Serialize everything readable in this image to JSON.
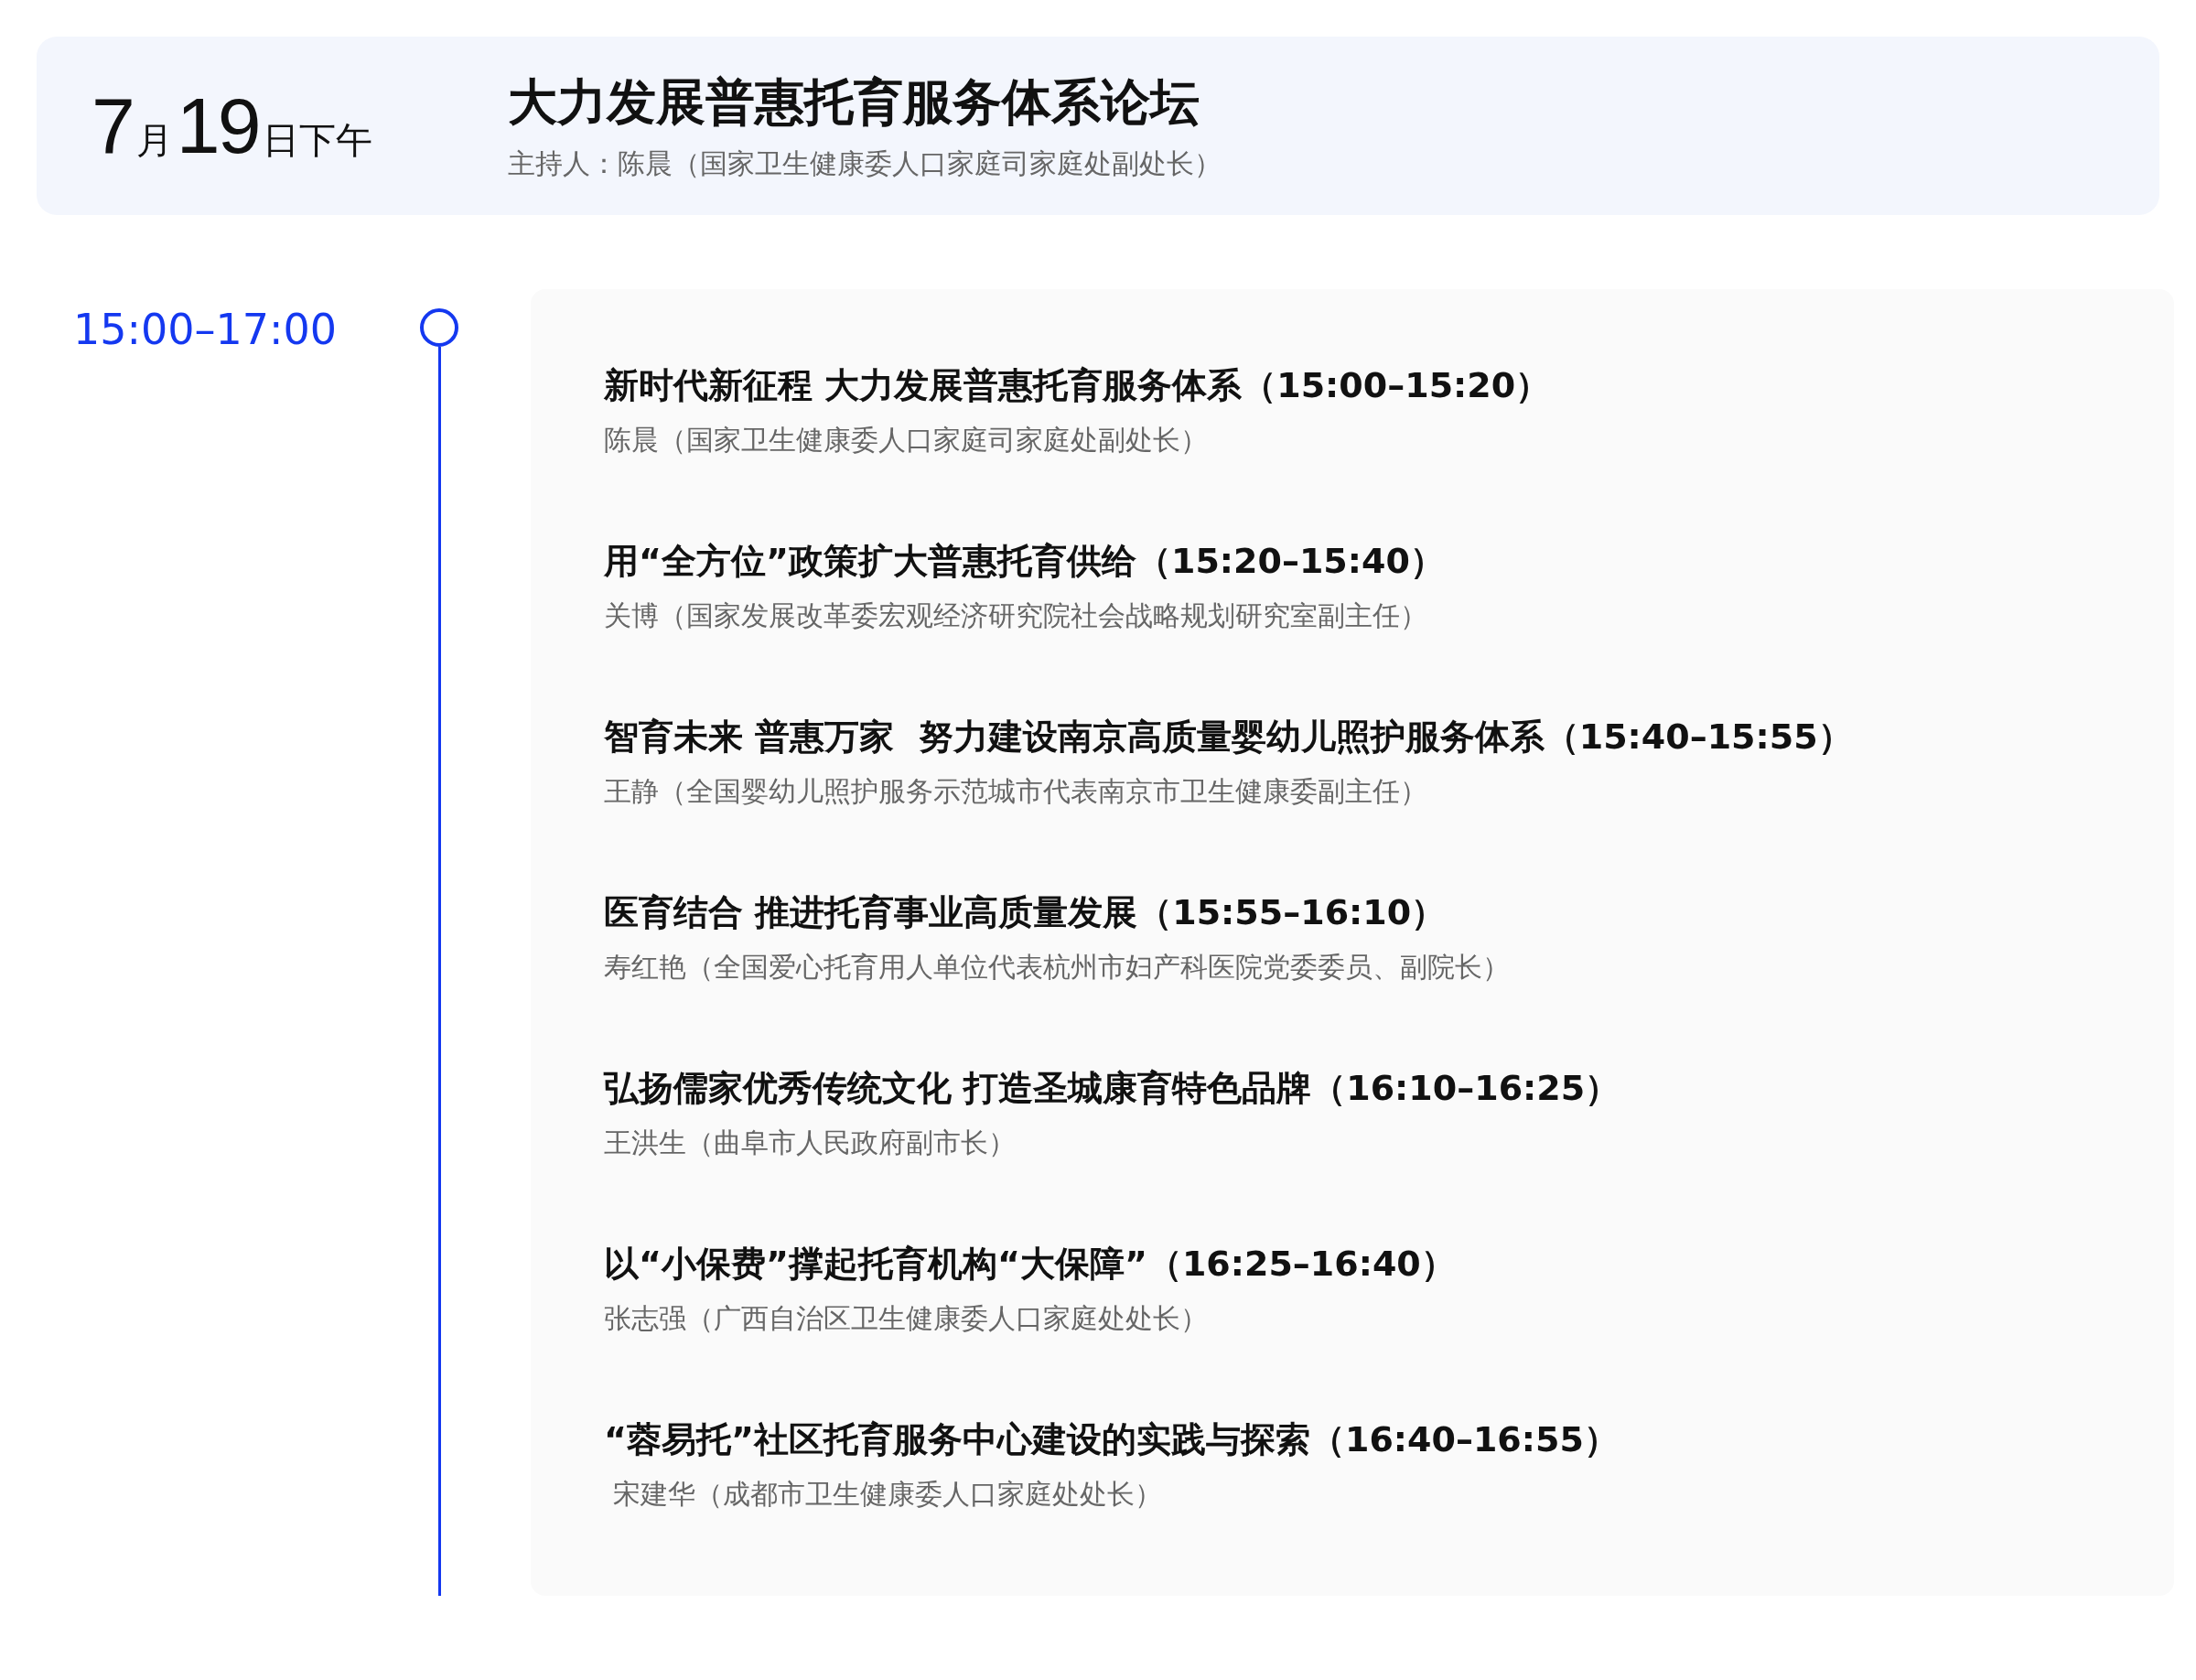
{
  "header": {
    "date": {
      "month": "7",
      "month_unit": "月",
      "day": "19",
      "day_unit": "日下午"
    },
    "title": "大力发展普惠托育服务体系论坛",
    "host": "主持人：陈晨（国家卫生健康委人口家庭司家庭处副处长）"
  },
  "session": {
    "time": "15:00–17:00",
    "talks": [
      {
        "title": "新时代新征程 大力发展普惠托育服务体系（15:00–15:20）",
        "speaker": "陈晨（国家卫生健康委人口家庭司家庭处副处长）"
      },
      {
        "title": "用“全方位”政策扩大普惠托育供给（15:20–15:40）",
        "speaker": "关博（国家发展改革委宏观经济研究院社会战略规划研究室副主任）"
      },
      {
        "title": "智育未来 普惠万家  努力建设南京高质量婴幼儿照护服务体系（15:40–15:55）",
        "speaker": "王静（全国婴幼儿照护服务示范城市代表南京市卫生健康委副主任）"
      },
      {
        "title": "医育结合 推进托育事业高质量发展（15:55–16:10）",
        "speaker": "寿红艳（全国爱心托育用人单位代表杭州市妇产科医院党委委员、副院长）"
      },
      {
        "title": "弘扬儒家优秀传统文化 打造圣城康育特色品牌（16:10–16:25）",
        "speaker": "王洪生（曲阜市人民政府副市长）"
      },
      {
        "title": "以“小保费”撑起托育机构“大保障”（16:25–16:40）",
        "speaker": "张志强（广西自治区卫生健康委人口家庭处处长）"
      },
      {
        "title": "“蓉易托”社区托育服务中心建设的实践与探索（16:40–16:55）",
        "speaker": " 宋建华（成都市卫生健康委人口家庭处处长）"
      }
    ]
  }
}
